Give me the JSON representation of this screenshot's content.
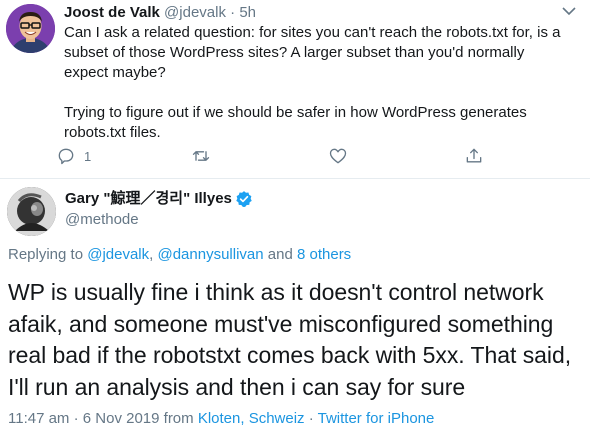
{
  "tweet1": {
    "author_name": "Joost de Valk",
    "author_handle": "@jdevalk",
    "separator": "·",
    "time": "5h",
    "paragraph1": "Can I ask a related question: for sites you can't reach the robots.txt for, is a subset of those WordPress sites? A larger subset than you'd normally expect maybe?",
    "paragraph2": "Trying to figure out if we should be safer in how WordPress generates robots.txt files.",
    "reply_count": "1",
    "icons": [
      "reply-icon",
      "retweet-icon",
      "like-icon",
      "share-icon",
      "caret-down-icon"
    ]
  },
  "tweet2": {
    "author_name": "Gary \"鯨理／경리\" Illyes",
    "author_handle": "@methode",
    "replying_prefix": "Replying to ",
    "replying_user1": "@jdevalk",
    "replying_comma": ", ",
    "replying_user2": "@dannysullivan",
    "replying_and": " and ",
    "replying_others": "8 others",
    "text": "WP is usually fine i think as it doesn't control network afaik, and someone must've misconfigured something real bad if the robotstxt comes back with 5xx. That said, I'll run an analysis and then i can say for sure",
    "time_date": "11:47 am · 6 Nov 2019 from ",
    "location": "Kloten, Schweiz",
    "meta_sep": " · ",
    "source": "Twitter for iPhone"
  },
  "colors": {
    "link": "#1b95e0",
    "muted": "#657786",
    "verified": "#1da1f2",
    "text": "#14171a"
  }
}
